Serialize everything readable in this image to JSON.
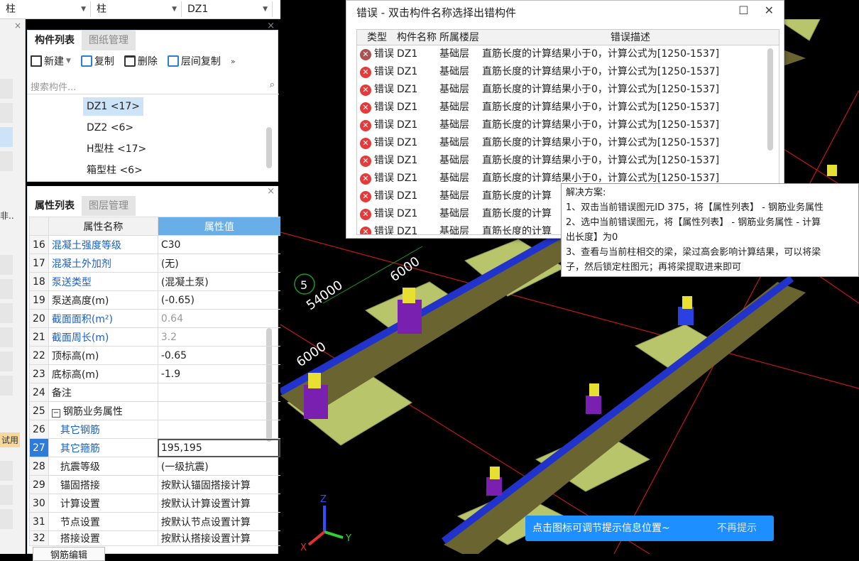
{
  "topbar": {
    "dd1": "柱",
    "dd2": "柱",
    "dd3": "DZ1"
  },
  "left_strip": {
    "text1": "非..",
    "text2": "试用"
  },
  "component_panel": {
    "tabs": [
      "构件列表",
      "图纸管理"
    ],
    "toolbar": {
      "new": "新建",
      "copy": "复制",
      "delete": "删除",
      "floor_copy": "层间复制"
    },
    "search_placeholder": "搜索构件...",
    "items": [
      "DZ1 <17>",
      "DZ2 <6>",
      "H型柱 <17>",
      "箱型柱 <6>"
    ]
  },
  "property_panel": {
    "tabs": [
      "属性列表",
      "图层管理"
    ],
    "headers": [
      "属性名称",
      "属性值"
    ],
    "rows": [
      {
        "n": "16",
        "name": "混凝土强度等级",
        "val": "C30"
      },
      {
        "n": "17",
        "name": "混凝土外加剂",
        "val": "(无)"
      },
      {
        "n": "18",
        "name": "泵送类型",
        "val": "(混凝土泵)"
      },
      {
        "n": "19",
        "name": "泵送高度(m)",
        "val": "(-0.65)"
      },
      {
        "n": "20",
        "name": "截面面积(m²)",
        "val": "0.64"
      },
      {
        "n": "21",
        "name": "截面周长(m)",
        "val": "3.2"
      },
      {
        "n": "22",
        "name": "顶标高(m)",
        "val": "-0.65"
      },
      {
        "n": "23",
        "name": "底标高(m)",
        "val": "-1.9"
      },
      {
        "n": "24",
        "name": "备注",
        "val": ""
      },
      {
        "n": "25",
        "name": "钢筋业务属性",
        "val": ""
      },
      {
        "n": "26",
        "name": "其它钢筋",
        "val": ""
      },
      {
        "n": "27",
        "name": "其它箍筋",
        "val": "195,195"
      },
      {
        "n": "28",
        "name": "抗震等级",
        "val": "(一级抗震)"
      },
      {
        "n": "29",
        "name": "锚固搭接",
        "val": "按默认锚固搭接计算"
      },
      {
        "n": "30",
        "name": "计算设置",
        "val": "按默认计算设置计算"
      },
      {
        "n": "31",
        "name": "节点设置",
        "val": "按默认节点设置计算"
      },
      {
        "n": "32",
        "name": "搭接设置",
        "val": "按默认搭接设置计算"
      }
    ],
    "bottom_button": "钢筋编辑"
  },
  "viewport": {
    "label_5": "5",
    "dim1": "54000",
    "dim2": "6000",
    "dim3": "6000"
  },
  "error_window": {
    "title": "错误 - 双击构件名称选择出错构件",
    "headers": [
      "类型",
      "构件名称",
      "所属楼层",
      "错误描述"
    ],
    "rows": [
      {
        "type": "错误",
        "name": "DZ1",
        "floor": "基础层",
        "desc": "直筋长度的计算结果小于0，计算公式为[1250-1537]"
      },
      {
        "type": "错误",
        "name": "DZ1",
        "floor": "基础层",
        "desc": "直筋长度的计算结果小于0，计算公式为[1250-1537]"
      },
      {
        "type": "错误",
        "name": "DZ1",
        "floor": "基础层",
        "desc": "直筋长度的计算结果小于0，计算公式为[1250-1537]"
      },
      {
        "type": "错误",
        "name": "DZ1",
        "floor": "基础层",
        "desc": "直筋长度的计算结果小于0，计算公式为[1250-1537]"
      },
      {
        "type": "错误",
        "name": "DZ1",
        "floor": "基础层",
        "desc": "直筋长度的计算结果小于0，计算公式为[1250-1537]"
      },
      {
        "type": "错误",
        "name": "DZ1",
        "floor": "基础层",
        "desc": "直筋长度的计算结果小于0，计算公式为[1250-1537]"
      },
      {
        "type": "错误",
        "name": "DZ1",
        "floor": "基础层",
        "desc": "直筋长度的计算结果小于0，计算公式为[1250-1537]"
      },
      {
        "type": "错误",
        "name": "DZ1",
        "floor": "基础层",
        "desc": "直筋长度的计算结果小于0，计算公式为[1250-1537]"
      },
      {
        "type": "错误",
        "name": "DZ1",
        "floor": "基础层",
        "desc": "直筋长度的计算"
      },
      {
        "type": "错误",
        "name": "DZ1",
        "floor": "基础层",
        "desc": "直筋长度的计算"
      },
      {
        "type": "错误",
        "name": "DZ1",
        "floor": "基础层",
        "desc": "直筋长度的计算"
      }
    ]
  },
  "tooltip": {
    "lines": [
      "解决方案:",
      "1、双击当前错误图元ID 375，将【属性列表】 - 钢筋业务属性",
      "2、选中当前错误图元，将【属性列表】 - 钢筋业务属性 - 计算",
      "出长度】为0",
      "3、查看与当前柱相交的梁，梁过高会影响计算结果，可以将梁",
      "子，然后锁定柱图元；再将梁提取进来即可"
    ]
  },
  "hint": {
    "text": "点击图标可调节提示信息位置~",
    "dismiss": "不再提示"
  }
}
